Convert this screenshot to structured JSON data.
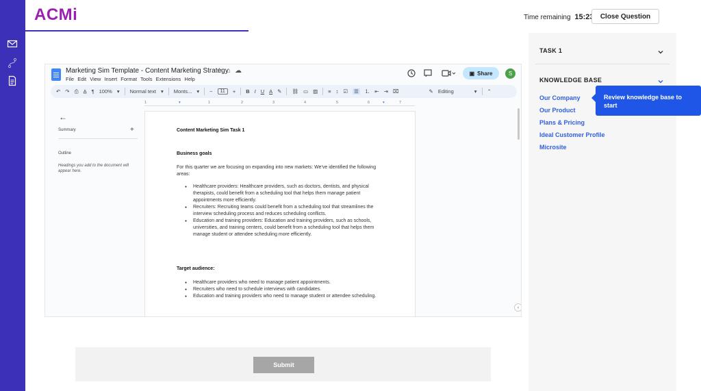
{
  "app": {
    "logo": "ACMi"
  },
  "header": {
    "time_label": "Time remaining",
    "time_value": "15:23",
    "close_label": "Close Question"
  },
  "rail": {
    "icons": [
      "mail-icon",
      "route-icon",
      "document-icon"
    ]
  },
  "colors": {
    "brand": "#3c2fb8",
    "logo": "#9b1fb0",
    "link": "#2f5fe0",
    "tooltip": "#1f56e8",
    "submit_disabled": "#a6a6a6"
  },
  "right_panel": {
    "task_title": "TASK 1",
    "kb_title": "KNOWLEDGE BASE",
    "kb_links": [
      "Our Company",
      "Our Product",
      "Plans & Pricing",
      "Ideal Customer Profile",
      "Microsite"
    ],
    "tooltip": "Review knowledge base to start"
  },
  "doc": {
    "title": "Marketing Sim Template - Content Marketing Strategy",
    "menus": [
      "File",
      "Edit",
      "View",
      "Insert",
      "Format",
      "Tools",
      "Extensions",
      "Help"
    ],
    "share_label": "Share",
    "account_initial": "S",
    "toolbar": {
      "zoom": "100%",
      "style": "Normal text",
      "font": "Monts...",
      "font_size": "11",
      "mode": "Editing"
    },
    "ruler_numbers": [
      "1",
      "1",
      "2",
      "3",
      "4",
      "5",
      "6",
      "7"
    ],
    "outline": {
      "summary_label": "Summary",
      "outline_label": "Outline",
      "hint": "Headings you add to the document will appear here."
    },
    "content": {
      "title": "Content Marketing Sim Task 1",
      "goals_heading": "Business goals",
      "goals_text": "For this quarter we are focusing on expanding into new markets: We've identified the following areas:",
      "goals_items": [
        "Healthcare providers: Healthcare providers, such as doctors, dentists, and physical therapists, could benefit from a scheduling tool that helps them manage patient appointments more efficiently.",
        "Recruiters: Recruiting teams could benefit from a scheduling tool that streamlines the interview scheduling process and reduces scheduling conflicts.",
        "Education and training providers: Education and training providers, such as schools, universities, and training centers, could benefit from a scheduling tool that helps them manage student or attendee scheduling more efficiently."
      ],
      "audience_heading": "Target audience:",
      "audience_items": [
        "Healthcare providers who need to manage patient appointments.",
        "Recruiters who need to schedule interviews with candidates.",
        "Education and training providers who need to manage student or attendee scheduling."
      ]
    }
  },
  "footer": {
    "submit_label": "Submit"
  }
}
